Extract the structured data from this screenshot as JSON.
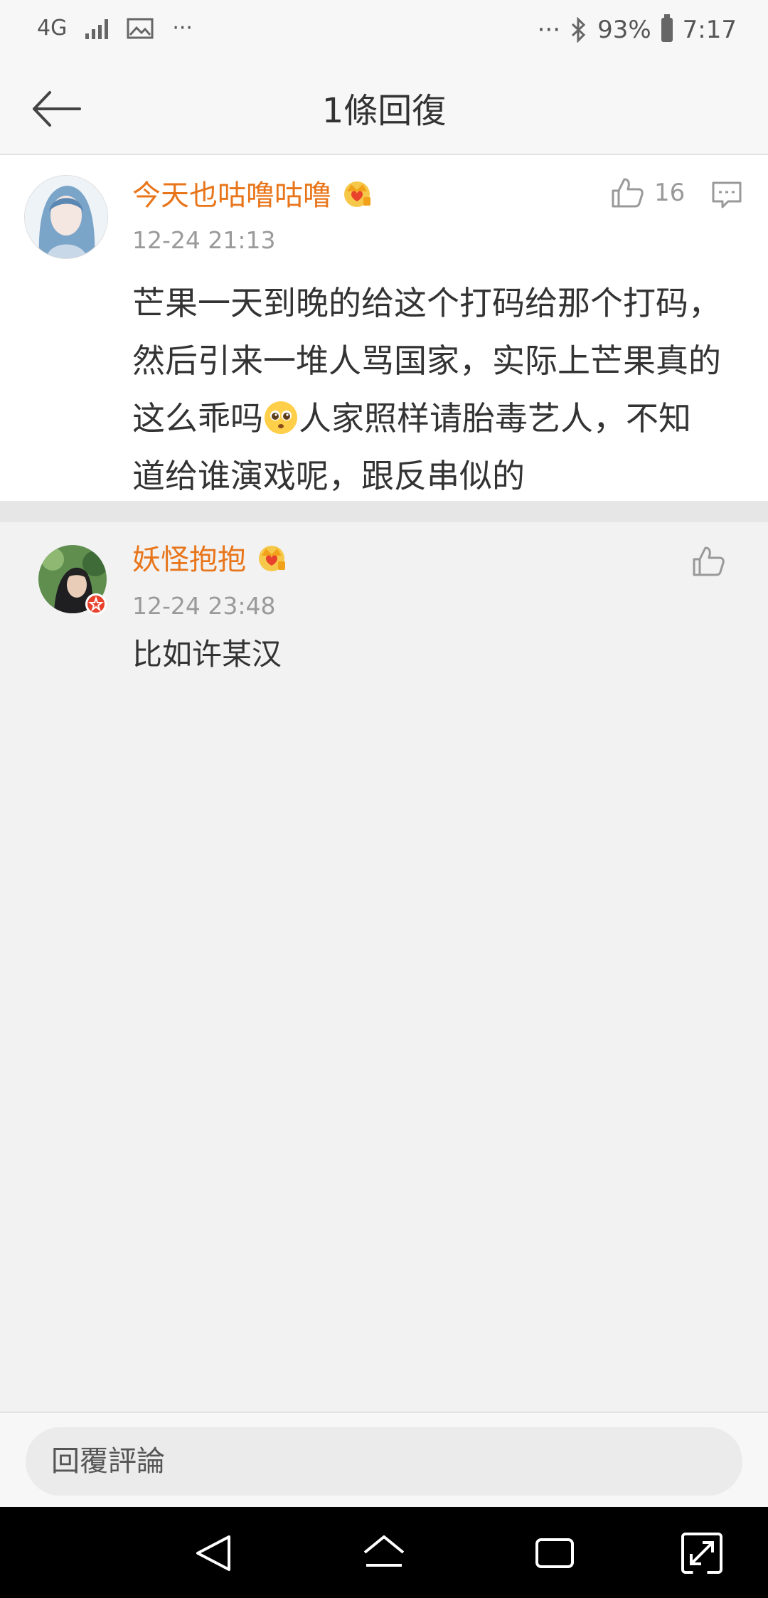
{
  "status_bar": {
    "network": "4G",
    "left_more": "···",
    "right_more": "···",
    "battery": "93%",
    "time": "7:17",
    "icons": [
      "signal-icon",
      "image-icon",
      "bluetooth-icon",
      "battery-icon"
    ]
  },
  "header": {
    "title": "1條回復",
    "back_icon": "back-arrow-icon"
  },
  "main_comment": {
    "username": "今天也咕噜咕噜",
    "timestamp": "12-24 21:13",
    "likes": "16",
    "text_parts": [
      "芒果一天到晚的给这个打码给那个打码，然后引来一堆人骂国家，实际上芒果真的这么乖吗",
      "人家照样请胎毒艺人，不知道给谁演戏呢，跟反串似的"
    ],
    "emoji": "pleading-face-emoji"
  },
  "reply": {
    "username": "妖怪抱抱",
    "timestamp": "12-24 23:48",
    "text": "比如许某汉"
  },
  "input": {
    "placeholder": "回覆評論"
  },
  "colors": {
    "username": "#e8751a",
    "background": "#f2f2f2",
    "card": "#ffffff",
    "timestamp": "#9a9a9a"
  }
}
